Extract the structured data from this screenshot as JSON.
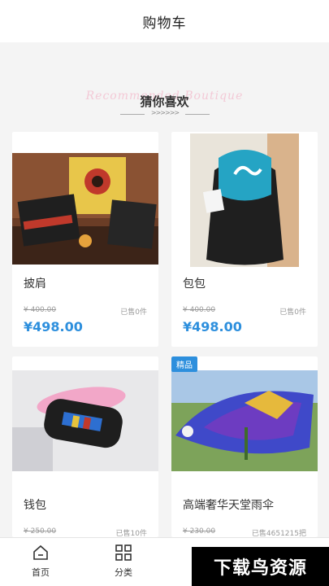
{
  "header": {
    "title": "购物车"
  },
  "recommend": {
    "ghost_text": "Recommended Boutique",
    "title": "猜你喜欢",
    "arrows": ">>>>>>"
  },
  "products": [
    {
      "name": "披肩",
      "old_price": "¥ 400.00",
      "sold": "已售0件",
      "price": "¥498.00",
      "badge": ""
    },
    {
      "name": "包包",
      "old_price": "¥ 400.00",
      "sold": "已售0件",
      "price": "¥498.00",
      "badge": ""
    },
    {
      "name": "钱包",
      "old_price": "¥ 250.00",
      "sold": "已售10件",
      "price": "",
      "badge": ""
    },
    {
      "name": "高端奢华天堂雨伞",
      "old_price": "¥ 230.00",
      "sold": "已售4651215把",
      "price": "",
      "badge": "精品"
    }
  ],
  "tabbar": {
    "home": {
      "label": "首页",
      "icon": "home-icon"
    },
    "category": {
      "label": "分类",
      "icon": "grid-icon"
    }
  },
  "watermark": {
    "text": "下载鸟资源"
  },
  "colors": {
    "accent": "#2d8fdd",
    "background": "#f4f4f4"
  }
}
